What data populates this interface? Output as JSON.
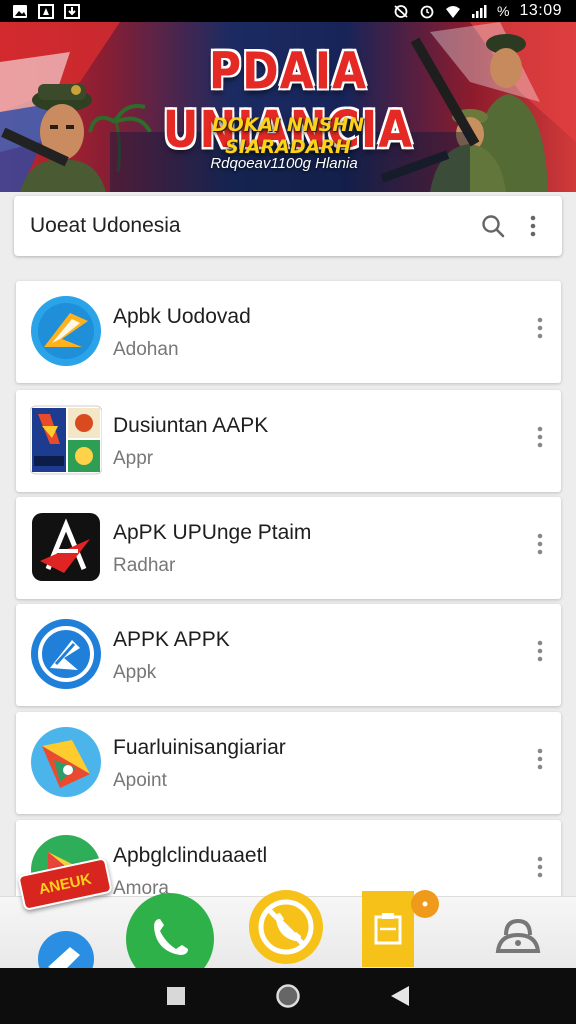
{
  "status_bar": {
    "battery_text": "%",
    "time": "13:09",
    "left_icons": [
      "image-icon",
      "notification-icon",
      "download-icon"
    ],
    "right_icons": [
      "mute-icon",
      "alarm-icon",
      "wifi-icon",
      "signal-icon"
    ]
  },
  "banner": {
    "title": "PDAIA UNIANCIA",
    "subtitle": "DOKAI NNSHN SIARADARH",
    "tagline": "Rdqoeav1100g Hlania"
  },
  "search": {
    "text": "Uoeat Udonesia",
    "search_icon": "search-icon",
    "more_icon": "more-vert-icon"
  },
  "apps": [
    {
      "title": "Apbk Uodovad",
      "subtitle": "Adohan",
      "icon": "app-logo-blue-icon"
    },
    {
      "title": "Dusiuntan AAPK",
      "subtitle": "Appr",
      "icon": "app-logo-grid-icon"
    },
    {
      "title": "ApPK UPUnge Ptaim",
      "subtitle": "Radhar",
      "icon": "app-logo-red-black-icon"
    },
    {
      "title": "APPK APPK",
      "subtitle": "Appk",
      "icon": "app-logo-blue-circle-icon"
    },
    {
      "title": "Fuarluinisangiariar",
      "subtitle": "Apoint",
      "icon": "app-logo-play-icon"
    },
    {
      "title": "Apbglclinduaaetl",
      "subtitle": "Amora",
      "icon": "app-logo-green-icon"
    }
  ],
  "dock": {
    "sticker_text": "ANEUK",
    "items": [
      "phone-icon",
      "no-call-icon",
      "clipboard-icon",
      "lock-icon"
    ],
    "badge_color": "#f09a1b"
  },
  "nav": {
    "items": [
      "recents-icon",
      "home-icon",
      "back-icon"
    ]
  },
  "colors": {
    "accent_red": "#e52a25",
    "accent_yellow": "#ffd21a",
    "phone_green": "#2fb14a",
    "clipboard_yellow": "#f6c21a"
  }
}
